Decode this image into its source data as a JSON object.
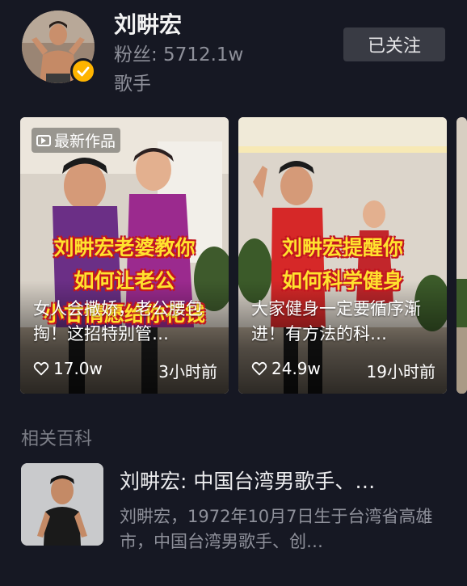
{
  "profile": {
    "name": "刘畊宏",
    "fans": "粉丝: 5712.1w",
    "title": "歌手",
    "follow_label": "已关注"
  },
  "videos": [
    {
      "badge": "最新作品",
      "overlay": [
        "刘畊宏老婆教你",
        "如何让老公",
        "小甘情愿给你花钱"
      ],
      "caption": "女人会撒娇，老公腰包掏！这招特别管…",
      "likes": "17.0w",
      "time": "3小时前"
    },
    {
      "overlay": [
        "刘畊宏提醒你",
        "如何科学健身"
      ],
      "caption": "大家健身一定要循序渐进！有方法的科…",
      "likes": "24.9w",
      "time": "19小时前"
    }
  ],
  "baike": {
    "section_label": "相关百科",
    "title": "刘畊宏: 中国台湾男歌手、…",
    "description": "刘畊宏，1972年10月7日生于台湾省高雄市，中国台湾男歌手、创…"
  },
  "colors": {
    "background": "#161823",
    "accent_badge": "#ffb400",
    "overlay_text": "#ffe22e"
  },
  "icons": {
    "verified": "verified-check-icon",
    "badge": "video-play-icon",
    "likes": "heart-outline-icon"
  }
}
